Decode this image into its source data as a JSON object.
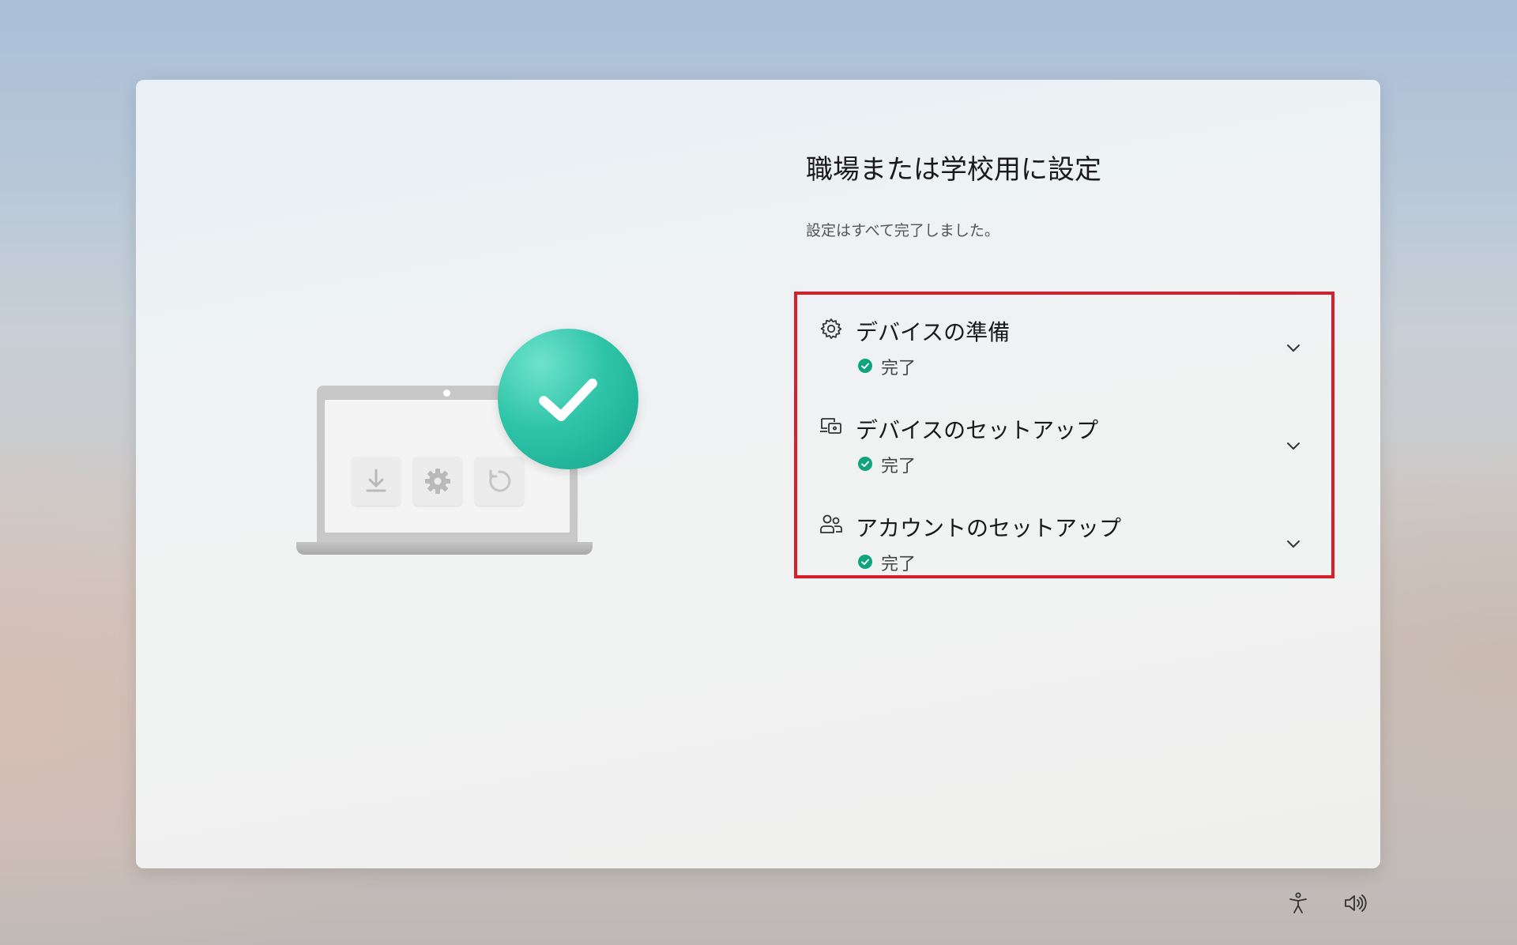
{
  "header": {
    "title": "職場または学校用に設定",
    "subtitle": "設定はすべて完了しました。"
  },
  "illustration": {
    "icons": [
      "download-icon",
      "gear-icon",
      "refresh-icon",
      "checkmark-icon"
    ],
    "accent_color": "#20b89c"
  },
  "steps": [
    {
      "icon": "gear-icon",
      "label": "デバイスの準備",
      "status": "完了"
    },
    {
      "icon": "devices-icon",
      "label": "デバイスのセットアップ",
      "status": "完了"
    },
    {
      "icon": "people-icon",
      "label": "アカウントのセットアップ",
      "status": "完了"
    }
  ],
  "highlight_color": "#d61f2b",
  "status_color": "#10a37f",
  "taskbar": {
    "icons": [
      "accessibility-icon",
      "volume-icon"
    ]
  }
}
